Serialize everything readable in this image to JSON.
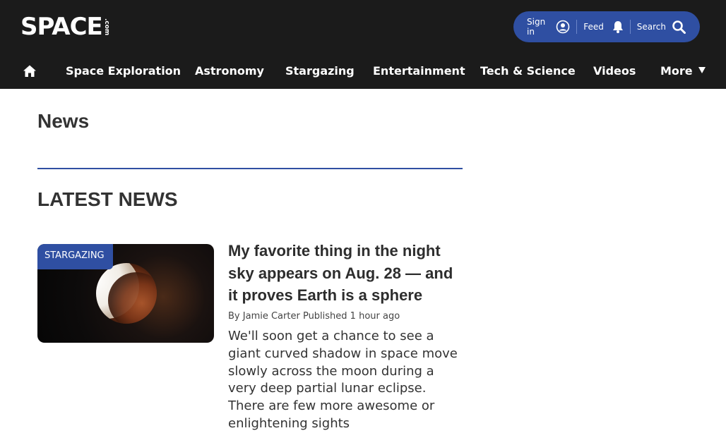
{
  "header": {
    "logo_main": "SPACE",
    "logo_sub": ".com",
    "utility": {
      "signin_label": "Sign in",
      "feed_label": "Feed",
      "search_label": "Search"
    },
    "accent_color": "#2f4fa2",
    "background_color": "#1b1b1b"
  },
  "nav": {
    "items": [
      {
        "label": "Space Exploration"
      },
      {
        "label": "Astronomy"
      },
      {
        "label": "Stargazing"
      },
      {
        "label": "Entertainment"
      },
      {
        "label": "Tech & Science"
      },
      {
        "label": "Videos"
      },
      {
        "label": "More"
      }
    ]
  },
  "main": {
    "page_title": "News",
    "section_heading": "LATEST NEWS",
    "articles": [
      {
        "category": "STARGAZING",
        "thumbnail_icon": "lunar-eclipse-image",
        "title": "My favorite thing in the night sky appears on Aug. 28 — and it proves Earth is a sphere",
        "byline_prefix": "By",
        "author": "Jamie Carter",
        "published": "Published 1 hour ago",
        "excerpt": "We'll soon get a chance to see a giant curved shadow in space move slowly across the moon during a very deep partial lunar eclipse. There are few more awesome or enlightening sights"
      }
    ]
  }
}
